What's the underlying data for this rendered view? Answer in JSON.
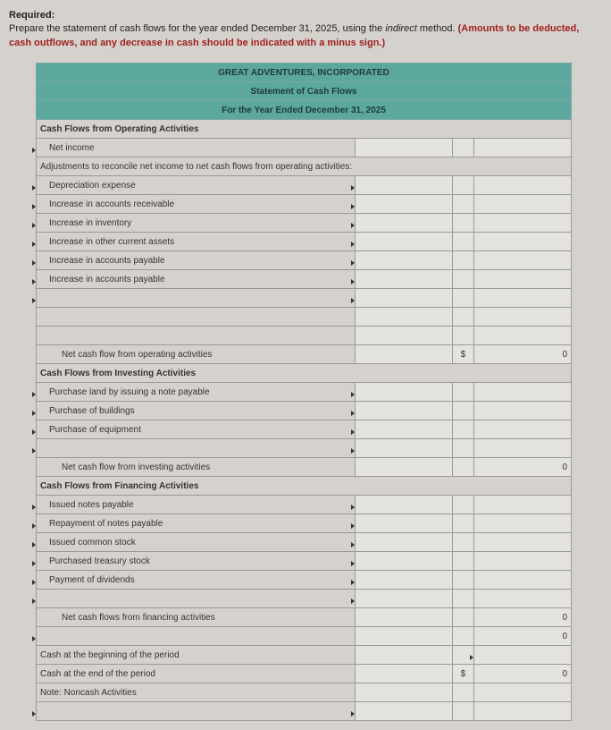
{
  "instructions": {
    "required_label": "Required:",
    "line1a": "Prepare the statement of cash flows for the year ended December 31, 2025, using the ",
    "line1b": "indirect",
    "line1c": " method. ",
    "line2": "(Amounts to be deducted, cash outflows, and any decrease in cash should be indicated with a minus sign.)"
  },
  "header": {
    "company": "GREAT ADVENTURES, INCORPORATED",
    "title": "Statement of Cash Flows",
    "period": "For the Year Ended December 31, 2025"
  },
  "sections": {
    "operating": {
      "title": "Cash Flows from Operating Activities",
      "net_income": "Net income",
      "adjustments": "Adjustments to reconcile net income to net cash flows from operating activities:",
      "items": {
        "dep": "Depreciation expense",
        "ar": "Increase in accounts receivable",
        "inv": "Increase in inventory",
        "oca": "Increase in other current assets",
        "ap1": "Increase in accounts payable",
        "ap2": "Increase in accounts payable"
      },
      "subtotal_label": "Net cash flow from operating activities",
      "subtotal_dollar": "$",
      "subtotal_value": "0"
    },
    "investing": {
      "title": "Cash Flows from Investing Activities",
      "items": {
        "land": "Purchase land by issuing a note payable",
        "bldg": "Purchase of buildings",
        "equip": "Purchase of equipment"
      },
      "subtotal_label": "Net cash flow from investing activities",
      "subtotal_value": "0"
    },
    "financing": {
      "title": "Cash Flows from Financing Activities",
      "items": {
        "issued_np": "Issued notes payable",
        "repay_np": "Repayment of notes payable",
        "common": "Issued common stock",
        "treasury": "Purchased treasury stock",
        "div": "Payment of dividends"
      },
      "subtotal_label": "Net cash flows from financing activities",
      "subtotal_value": "0",
      "net_change_value": "0"
    },
    "footer": {
      "begin": "Cash at the beginning of the period",
      "end": "Cash at the end of the period",
      "end_dollar": "$",
      "end_value": "0",
      "note": "Note: Noncash Activities"
    }
  }
}
